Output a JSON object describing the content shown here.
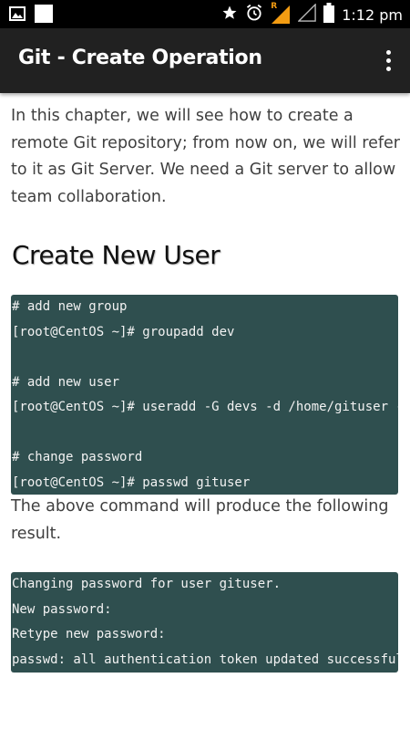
{
  "status_bar": {
    "time": "1:12 pm",
    "icons": [
      "image-icon",
      "white-square-icon",
      "star-icon",
      "alarm-icon",
      "signal-icon",
      "signal-empty-icon",
      "battery-icon"
    ],
    "roaming_letter": "R"
  },
  "app_bar": {
    "title": "Git - Create Operation",
    "menu_icon": "overflow-menu-icon"
  },
  "content": {
    "intro": "In this chapter, we will see how to create a remote Git repository; from now on, we will refer to it as Git Server. We need a Git server to allow team collaboration.",
    "heading": "Create New User",
    "code1": [
      "# add new group",
      "[root@CentOS ~]# groupadd dev",
      "",
      "# add new user",
      "[root@CentOS ~]# useradd -G devs -d /home/gituser -m -s /bin/bash gituser",
      "",
      "# change password",
      "[root@CentOS ~]# passwd gituser"
    ],
    "result_text": "The above command will produce the following result.",
    "code2": [
      "Changing password for user gituser.",
      "New password:",
      "Retype new password:",
      "passwd: all authentication token updated successfully."
    ]
  }
}
